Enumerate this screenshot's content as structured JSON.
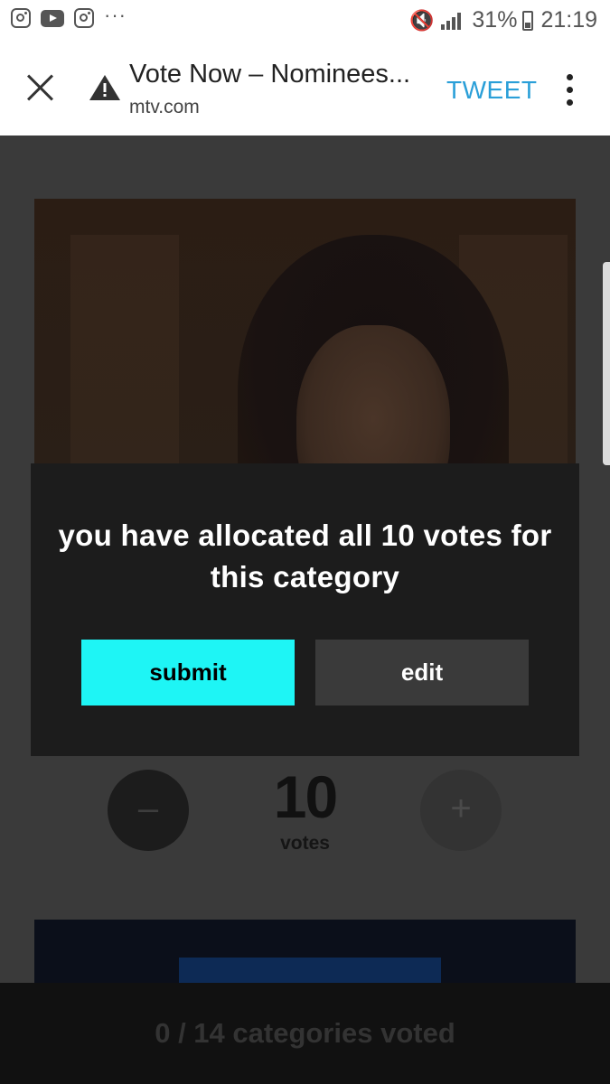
{
  "status_bar": {
    "left_icons": [
      "instagram-icon",
      "youtube-icon",
      "instagram-icon"
    ],
    "overflow": "···",
    "battery": "31%",
    "time": "21:19"
  },
  "browser": {
    "title": "Vote Now – Nominees...",
    "url": "mtv.com",
    "tweet_label": "TWEET"
  },
  "nominee": {
    "vote_count": "10",
    "vote_unit": "votes",
    "minus_label": "–",
    "plus_label": "+"
  },
  "modal": {
    "message": "you have allocated all 10 votes for this category",
    "submit_label": "submit",
    "edit_label": "edit"
  },
  "footer": {
    "progress": "0 / 14 categories voted"
  },
  "colors": {
    "accent": "#1ef5f5",
    "link": "#2a9fd8",
    "modal_bg": "#1c1c1c",
    "page_bg": "#3a3a3a"
  }
}
